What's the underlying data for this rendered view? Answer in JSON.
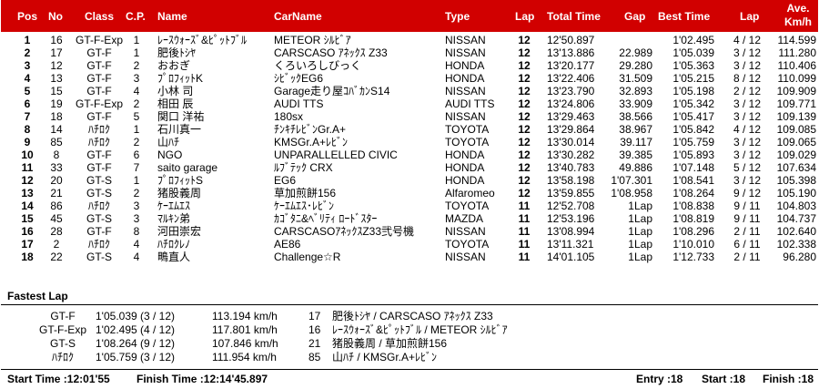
{
  "columns": {
    "pos": "Pos",
    "no": "No",
    "class": "Class",
    "cp": "C.P.",
    "name": "Name",
    "car_name": "CarName",
    "type": "Type",
    "lap": "Lap",
    "total_time": "Total Time",
    "gap": "Gap",
    "best_time": "Best Time",
    "best_lap": "Lap",
    "ave_line1": "Ave.",
    "ave_line2": "Km/h"
  },
  "rows": [
    {
      "pos": "1",
      "no": "16",
      "class": "GT-F-Exp",
      "cp": "1",
      "name": "ﾚｰｽｳｫｰｽﾞ&ﾋﾟｯﾄﾌﾞﾙ",
      "car": "METEOR ｼﾙﾋﾞｱ",
      "type": "NISSAN",
      "lap": "12",
      "total": "12'50.897",
      "gap": "",
      "best": "1'02.495",
      "best_lap": "4 / 12",
      "ave": "114.599"
    },
    {
      "pos": "2",
      "no": "17",
      "class": "GT-F",
      "cp": "1",
      "name": "肥後ﾄｼﾔ",
      "car": "CARSCASO ｱﾈｯｸｽ Z33",
      "type": "NISSAN",
      "lap": "12",
      "total": "13'13.886",
      "gap": "22.989",
      "best": "1'05.039",
      "best_lap": "3 / 12",
      "ave": "111.280"
    },
    {
      "pos": "3",
      "no": "12",
      "class": "GT-F",
      "cp": "2",
      "name": "おおぎ",
      "car": "くろいろしびっく",
      "type": "HONDA",
      "lap": "12",
      "total": "13'20.177",
      "gap": "29.280",
      "best": "1'05.363",
      "best_lap": "3 / 12",
      "ave": "110.406"
    },
    {
      "pos": "4",
      "no": "13",
      "class": "GT-F",
      "cp": "3",
      "name": "ﾌﾟﾛﾌｨｯﾄK",
      "car": "ｼﾋﾞｯｸEG6",
      "type": "HONDA",
      "lap": "12",
      "total": "13'22.406",
      "gap": "31.509",
      "best": "1'05.215",
      "best_lap": "8 / 12",
      "ave": "110.099"
    },
    {
      "pos": "5",
      "no": "15",
      "class": "GT-F",
      "cp": "4",
      "name": "小林 司",
      "car": "Garage走り屋ｺﾊﾞｶﾝS14",
      "type": "NISSAN",
      "lap": "12",
      "total": "13'23.790",
      "gap": "32.893",
      "best": "1'05.198",
      "best_lap": "2 / 12",
      "ave": "109.909"
    },
    {
      "pos": "6",
      "no": "19",
      "class": "GT-F-Exp",
      "cp": "2",
      "name": "相田 辰",
      "car": "AUDI TTS",
      "type": "AUDI TTS",
      "lap": "12",
      "total": "13'24.806",
      "gap": "33.909",
      "best": "1'05.342",
      "best_lap": "3 / 12",
      "ave": "109.771"
    },
    {
      "pos": "7",
      "no": "18",
      "class": "GT-F",
      "cp": "5",
      "name": "関口 洋祐",
      "car": "180sx",
      "type": "NISSAN",
      "lap": "12",
      "total": "13'29.463",
      "gap": "38.566",
      "best": "1'05.417",
      "best_lap": "3 / 12",
      "ave": "109.139"
    },
    {
      "pos": "8",
      "no": "14",
      "class": "ﾊﾁﾛｸ",
      "cp": "1",
      "name": "石川真一",
      "car": "ﾁﾝｷﾁﾚﾋﾞﾝGr.A+",
      "type": "TOYOTA",
      "lap": "12",
      "total": "13'29.864",
      "gap": "38.967",
      "best": "1'05.842",
      "best_lap": "4 / 12",
      "ave": "109.085"
    },
    {
      "pos": "9",
      "no": "85",
      "class": "ﾊﾁﾛｸ",
      "cp": "2",
      "name": "山ﾊﾁ",
      "car": "KMSGr.A+ﾚﾋﾞﾝ",
      "type": "TOYOTA",
      "lap": "12",
      "total": "13'30.014",
      "gap": "39.117",
      "best": "1'05.759",
      "best_lap": "3 / 12",
      "ave": "109.065"
    },
    {
      "pos": "10",
      "no": "8",
      "class": "GT-F",
      "cp": "6",
      "name": "NGO",
      "car": "UNPARALLELLED CIVIC",
      "type": "HONDA",
      "lap": "12",
      "total": "13'30.282",
      "gap": "39.385",
      "best": "1'05.893",
      "best_lap": "3 / 12",
      "ave": "109.029"
    },
    {
      "pos": "11",
      "no": "33",
      "class": "GT-F",
      "cp": "7",
      "name": "saito garage",
      "car": "ﾙﾌﾞﾃｯｸ CRX",
      "type": "HONDA",
      "lap": "12",
      "total": "13'40.783",
      "gap": "49.886",
      "best": "1'07.148",
      "best_lap": "5 / 12",
      "ave": "107.634"
    },
    {
      "pos": "12",
      "no": "20",
      "class": "GT-S",
      "cp": "1",
      "name": "ﾌﾟﾛﾌｨｯﾄS",
      "car": "EG6",
      "type": "HONDA",
      "lap": "12",
      "total": "13'58.198",
      "gap": "1'07.301",
      "best": "1'08.541",
      "best_lap": "3 / 12",
      "ave": "105.398"
    },
    {
      "pos": "13",
      "no": "21",
      "class": "GT-S",
      "cp": "2",
      "name": "猪股義周",
      "car": "草加煎餅156",
      "type": "Alfaromeo",
      "lap": "12",
      "total": "13'59.855",
      "gap": "1'08.958",
      "best": "1'08.264",
      "best_lap": "9 / 12",
      "ave": "105.190"
    },
    {
      "pos": "14",
      "no": "86",
      "class": "ﾊﾁﾛｸ",
      "cp": "3",
      "name": "ｹｰｴﾑｴｽ",
      "car": "ｹｰｴﾑｴｽ･ﾚﾋﾞﾝ",
      "type": "TOYOTA",
      "lap": "11",
      "total": "12'52.708",
      "gap": "1Lap",
      "best": "1'08.838",
      "best_lap": "9 / 11",
      "ave": "104.803"
    },
    {
      "pos": "15",
      "no": "45",
      "class": "GT-S",
      "cp": "3",
      "name": "ﾏﾙｷﾝ弟",
      "car": "ｶｺﾞﾀﾆ&ﾍﾞﾘﾃｨ ﾛｰﾄﾞｽﾀｰ",
      "type": "MAZDA",
      "lap": "11",
      "total": "12'53.196",
      "gap": "1Lap",
      "best": "1'08.819",
      "best_lap": "9 / 11",
      "ave": "104.737"
    },
    {
      "pos": "16",
      "no": "28",
      "class": "GT-F",
      "cp": "8",
      "name": "河田崇宏",
      "car": "CARSCASOｱﾈｯｸｽZ33弐号機",
      "type": "NISSAN",
      "lap": "11",
      "total": "13'08.994",
      "gap": "1Lap",
      "best": "1'08.296",
      "best_lap": "2 / 11",
      "ave": "102.640"
    },
    {
      "pos": "17",
      "no": "2",
      "class": "ﾊﾁﾛｸ",
      "cp": "4",
      "name": "ﾊﾁﾛｸﾚﾉ",
      "car": "AE86",
      "type": "TOYOTA",
      "lap": "11",
      "total": "13'11.321",
      "gap": "1Lap",
      "best": "1'10.010",
      "best_lap": "6 / 11",
      "ave": "102.338"
    },
    {
      "pos": "18",
      "no": "22",
      "class": "GT-S",
      "cp": "4",
      "name": "鴫直人",
      "car": "Challenge☆R",
      "type": "NISSAN",
      "lap": "11",
      "total": "14'01.105",
      "gap": "1Lap",
      "best": "1'12.733",
      "best_lap": "2 / 11",
      "ave": "96.280"
    }
  ],
  "fastest_lap": {
    "title": "Fastest Lap",
    "rows": [
      {
        "class": "GT-F",
        "time": "1'05.039 (3 / 12)",
        "speed": "113.194 km/h",
        "no": "17",
        "driver": "肥後ﾄｼﾔ / CARSCASO ｱﾈｯｸｽ Z33"
      },
      {
        "class": "GT-F-Exp",
        "time": "1'02.495 (4 / 12)",
        "speed": "117.801 km/h",
        "no": "16",
        "driver": "ﾚｰｽｳｫｰｽﾞ&ﾋﾟｯﾄﾌﾞﾙ / METEOR ｼﾙﾋﾞｱ"
      },
      {
        "class": "GT-S",
        "time": "1'08.264 (9 / 12)",
        "speed": "107.846 km/h",
        "no": "21",
        "driver": "猪股義周 / 草加煎餅156"
      },
      {
        "class": "ﾊﾁﾛｸ",
        "time": "1'05.759 (3 / 12)",
        "speed": "111.954 km/h",
        "no": "85",
        "driver": "山ﾊﾁ / KMSGr.A+ﾚﾋﾞﾝ"
      }
    ]
  },
  "footer": {
    "start_time": "Start Time :12:01'55",
    "finish_time": "Finish Time :12:14'45.897",
    "entry": "Entry :18",
    "start": "Start :18",
    "finish": "Finish :18"
  },
  "colors": {
    "header_bg": "#d10000",
    "header_text": "#ffffff"
  }
}
